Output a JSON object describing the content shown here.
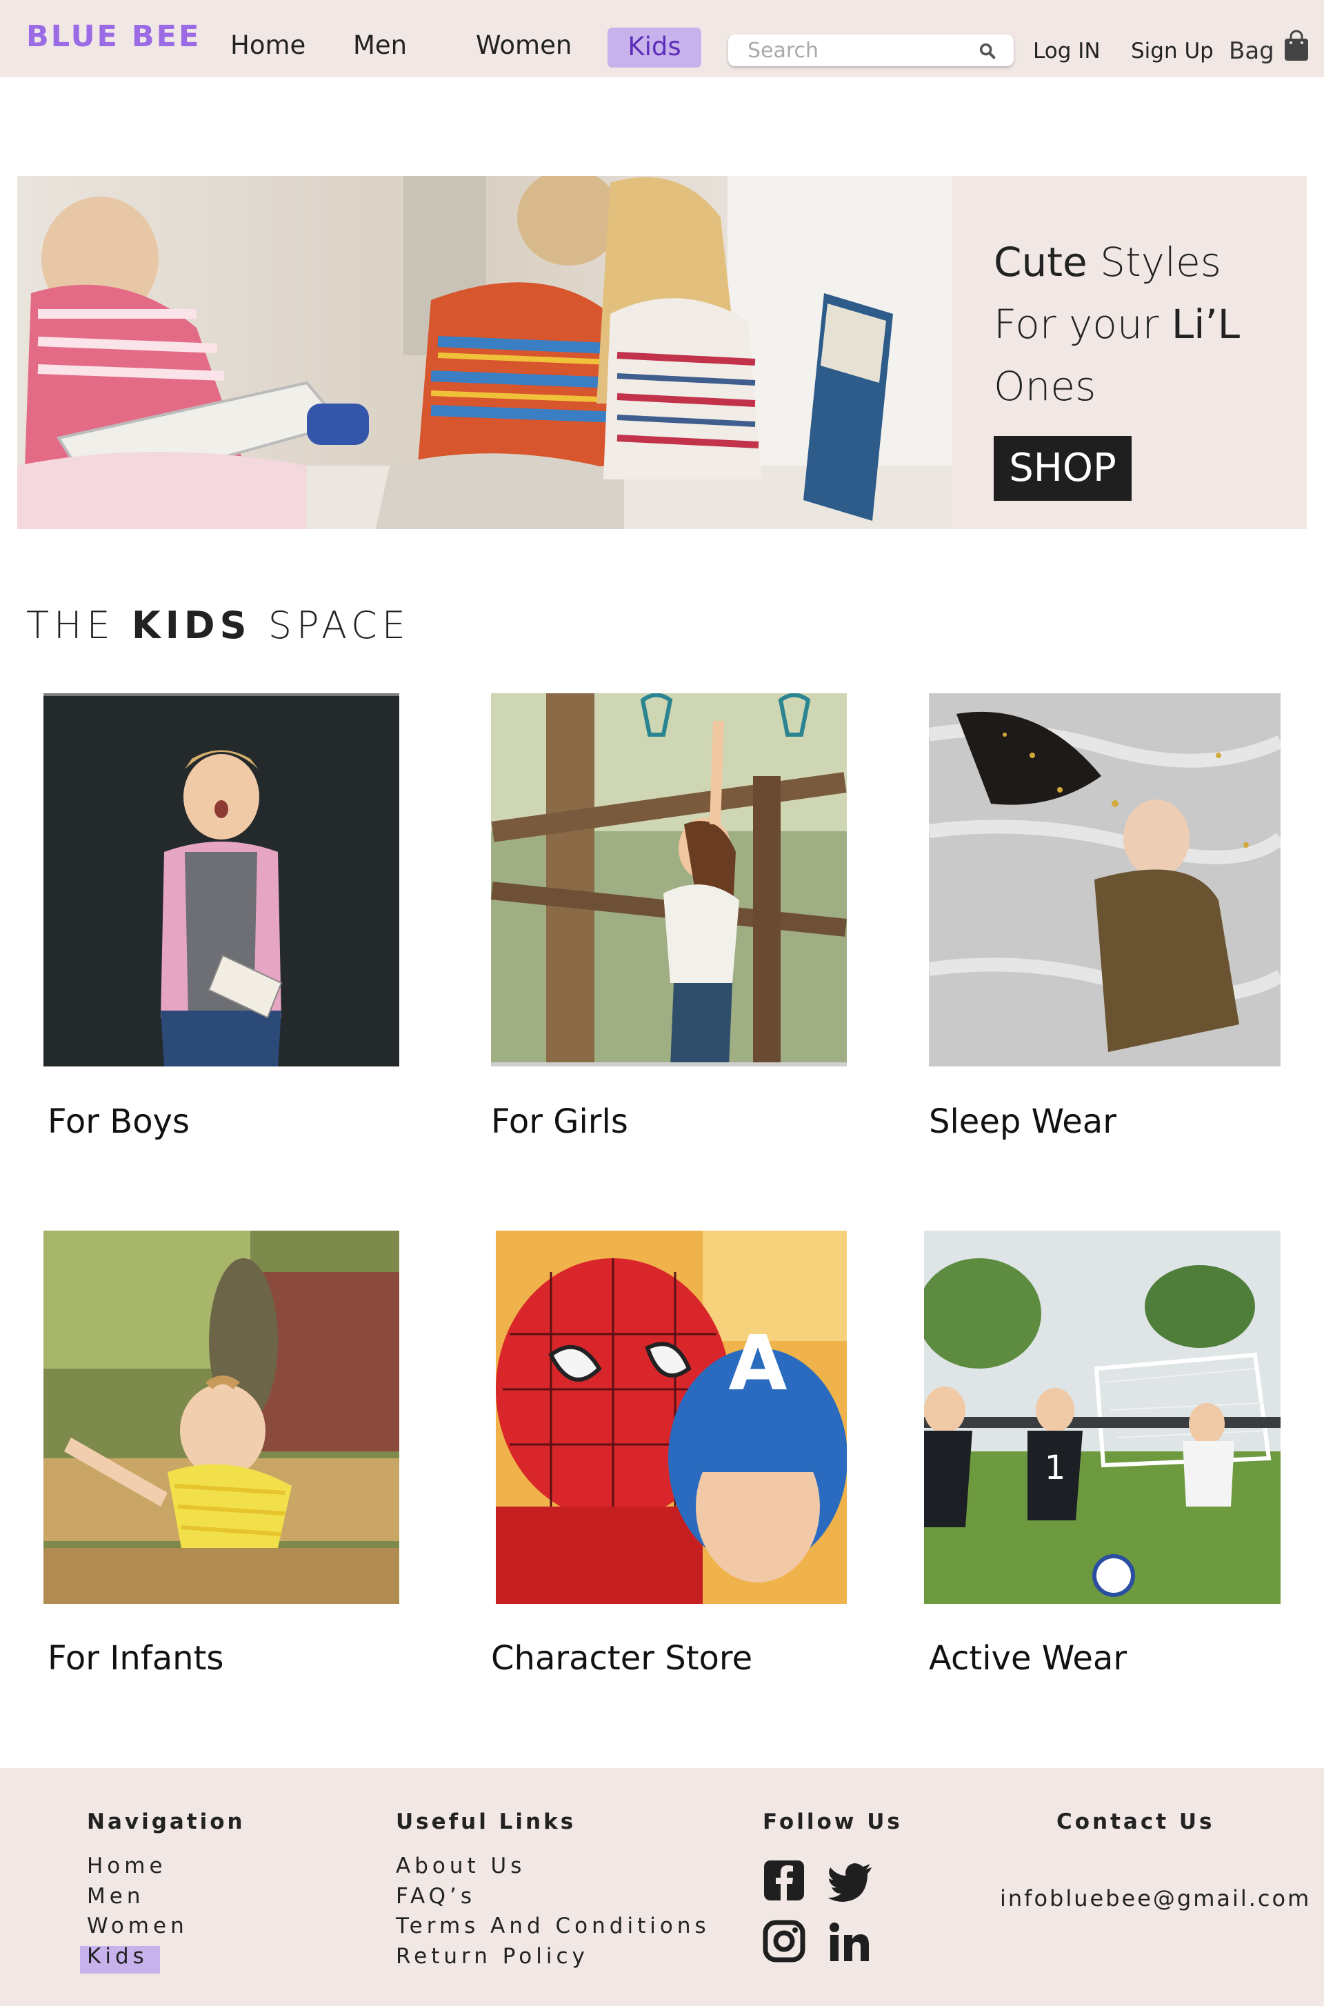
{
  "header": {
    "logo": "BLUE BEE",
    "nav": [
      "Home",
      "Men",
      "Women",
      "Kids"
    ],
    "active_nav": "Kids",
    "search_placeholder": "Search",
    "login": "Log IN",
    "signup": "Sign Up",
    "bag": "Bag"
  },
  "hero": {
    "line1_bold": "Cute",
    "line1_rest": " Styles",
    "line2_rest": "For your ",
    "line2_bold": "Li’L",
    "line3": "Ones",
    "cta": "SHOP"
  },
  "section": {
    "title_pre": "THE ",
    "title_bold": "KIDS",
    "title_post": " SPACE"
  },
  "categories": [
    {
      "label": "For Boys"
    },
    {
      "label": "For Girls"
    },
    {
      "label": "Sleep Wear"
    },
    {
      "label": "For Infants"
    },
    {
      "label": "Character Store"
    },
    {
      "label": "Active Wear"
    }
  ],
  "footer": {
    "nav_heading": "Navigation",
    "nav_links": [
      "Home",
      "Men",
      "Women",
      "Kids"
    ],
    "useful_heading": "Useful  Links",
    "useful_links": [
      "About Us",
      "FAQ’s",
      "Terms And Conditions",
      "Return Policy"
    ],
    "follow_heading": "Follow Us",
    "social": [
      "facebook-icon",
      "twitter-icon",
      "instagram-icon",
      "linkedin-icon"
    ],
    "contact_heading": "Contact Us",
    "email": "infobluebee@gmail.com"
  },
  "colors": {
    "brand": "#9b6be6",
    "active_bg": "#c8b2ec",
    "header_bg": "#f1e8e5",
    "button_bg": "#1f1f1f"
  }
}
